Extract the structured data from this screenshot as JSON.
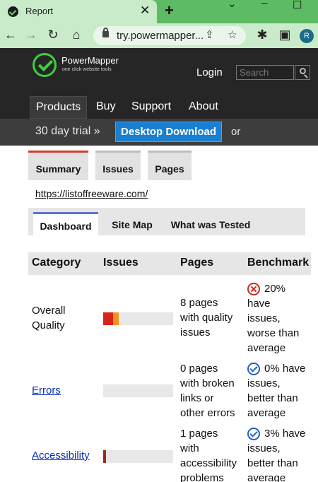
{
  "browser": {
    "tab_title": "Report",
    "tab_close": "✕",
    "new_tab": "+",
    "window_controls": {
      "minimize": "⌄",
      "restore": "–",
      "maximize": "☐"
    },
    "url": "try.powermapper...",
    "avatar_initial": "R"
  },
  "header": {
    "brand": "PowerMapper",
    "tagline": "one click website tools",
    "login": "Login",
    "search_placeholder": "Search"
  },
  "nav": [
    {
      "label": "Products",
      "active": true
    },
    {
      "label": "Buy"
    },
    {
      "label": "Support"
    },
    {
      "label": "About"
    }
  ],
  "trial": {
    "text": "30 day trial »",
    "download_label": "Desktop Download",
    "or": "or"
  },
  "report_tabs": [
    {
      "label": "Summary",
      "active": true
    },
    {
      "label": "Issues"
    },
    {
      "label": "Pages"
    }
  ],
  "site_url": "https://listoffreeware.com/",
  "sub_tabs": [
    {
      "label": "Dashboard",
      "active": true
    },
    {
      "label": "Site Map"
    },
    {
      "label": "What was Tested"
    }
  ],
  "table": {
    "headers": [
      "Category",
      "Issues",
      "Pages",
      "Benchmark"
    ],
    "rows": [
      {
        "category": [
          "Overall",
          "Quality"
        ],
        "link": false,
        "pages": [
          "8 pages",
          "with quality",
          "issues"
        ],
        "status": "bad",
        "benchmark": [
          "20%",
          "have",
          "issues,",
          "worse than",
          "average"
        ],
        "issue_fractions": [
          0.14,
          0.08
        ],
        "issue_colors": [
          "#d8251b",
          "#f0941e"
        ]
      },
      {
        "category": [
          "Errors"
        ],
        "link": true,
        "pages": [
          "0 pages",
          "with broken",
          "links or",
          "other errors"
        ],
        "status": "good",
        "benchmark": [
          "0% have",
          "issues,",
          "better than",
          "average"
        ],
        "issue_fractions": [],
        "issue_colors": []
      },
      {
        "category": [
          "Accessibility"
        ],
        "link": true,
        "pages": [
          "1 pages",
          "with",
          "accessibility",
          "problems"
        ],
        "status": "good",
        "benchmark": [
          "3% have",
          "issues,",
          "better than",
          "average"
        ],
        "issue_fractions": [
          0.04
        ],
        "issue_colors": [
          "#a3261c"
        ]
      }
    ]
  }
}
